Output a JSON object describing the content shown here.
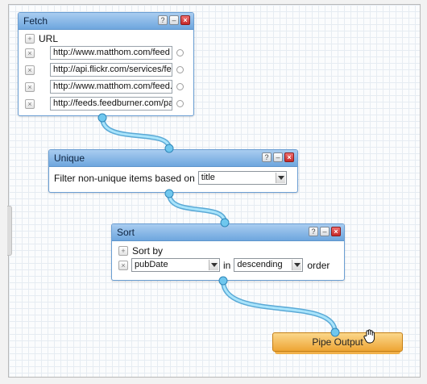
{
  "fetch": {
    "title": "Fetch",
    "url_label": "URL",
    "urls": [
      "http://www.matthom.com/feed",
      "http://api.flickr.com/services/fe",
      "http://www.matthom.com/feed.",
      "http://feeds.feedburner.com/pa"
    ]
  },
  "unique": {
    "title": "Unique",
    "filter_label": "Filter non-unique items based on",
    "field_value": "title"
  },
  "sort": {
    "title": "Sort",
    "sort_by_label": "Sort by",
    "field_value": "pubDate",
    "in_label": "in",
    "direction_value": "descending",
    "order_label": "order"
  },
  "output": {
    "label": "Pipe Output"
  },
  "colors": {
    "module_header": "#6ea6de",
    "wire": "#7fd0f2",
    "output": "#eea534",
    "close_button": "#c62828"
  },
  "icons": {
    "help": "help-icon",
    "minimize": "minimize-icon",
    "close": "close-icon",
    "add": "add-icon",
    "remove": "remove-icon",
    "pointer": "hand-cursor-icon"
  }
}
